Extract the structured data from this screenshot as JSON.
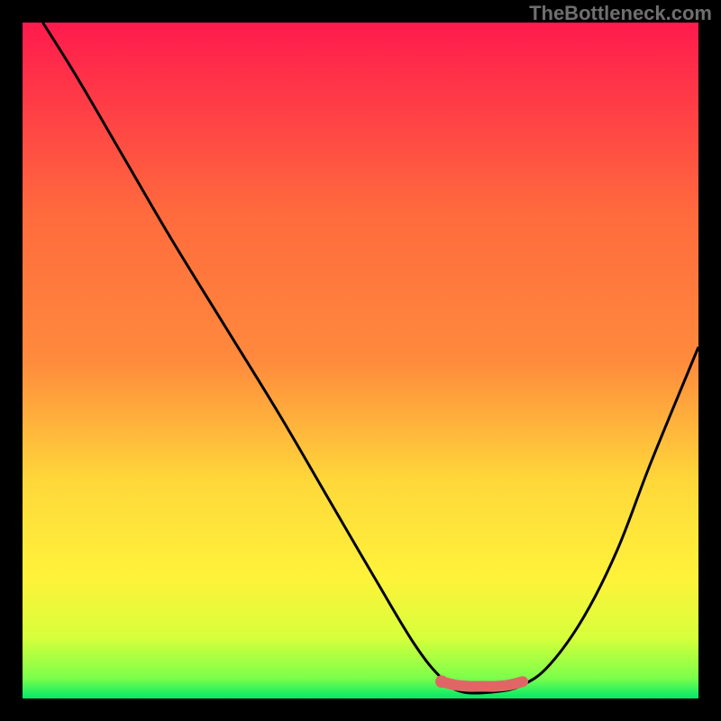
{
  "watermark": "TheBottleneck.com",
  "colors": {
    "frame": "#000000",
    "grad_top": "#ff1a4d",
    "grad_mid1": "#ff8a3d",
    "grad_mid2": "#ffd83a",
    "grad_mid3": "#fff23a",
    "grad_low": "#d7ff3a",
    "grad_bottom": "#00e86a",
    "curve": "#000000",
    "marker": "#e06666"
  },
  "chart_data": {
    "type": "line",
    "title": "",
    "xlabel": "",
    "ylabel": "",
    "xlim": [
      0,
      100
    ],
    "ylim": [
      0,
      100
    ],
    "series": [
      {
        "name": "bottleneck-curve",
        "x": [
          3,
          8,
          15,
          22,
          30,
          38,
          45,
          52,
          58,
          62,
          65,
          70,
          74,
          78,
          83,
          88,
          93,
          100
        ],
        "y": [
          100,
          92,
          80,
          68,
          55,
          42,
          30,
          18,
          8,
          3,
          1,
          1,
          2,
          5,
          12,
          22,
          35,
          52
        ]
      },
      {
        "name": "optimal-range-marker",
        "x": [
          62,
          64,
          66,
          68,
          70,
          72,
          74
        ],
        "y": [
          2.5,
          2.0,
          1.8,
          1.8,
          1.8,
          2.0,
          2.5
        ]
      }
    ],
    "annotations": []
  }
}
